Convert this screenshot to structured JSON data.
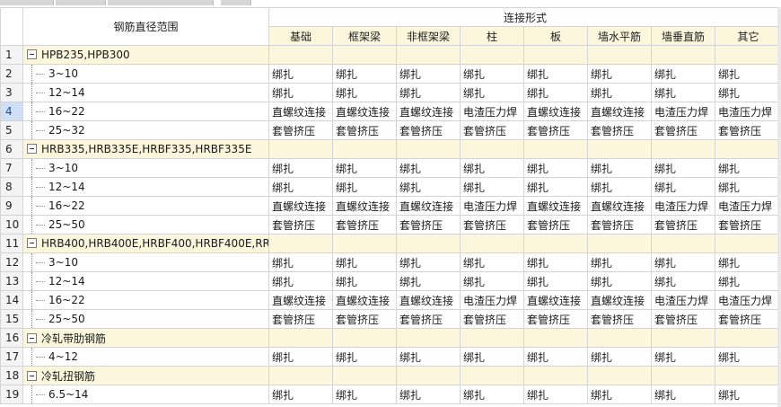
{
  "headers": {
    "range": "钢筋直径范围",
    "connection": "连接形式",
    "columns": [
      "基础",
      "框架梁",
      "非框架梁",
      "柱",
      "板",
      "墙水平筋",
      "墙垂直筋",
      "其它"
    ]
  },
  "selected_row": 4,
  "rows": [
    {
      "num": "1",
      "group": true,
      "label": "HPB235,HPB300",
      "cells": [
        "",
        "",
        "",
        "",
        "",
        "",
        "",
        ""
      ]
    },
    {
      "num": "2",
      "group": false,
      "label": "3~10",
      "cells": [
        "绑扎",
        "绑扎",
        "绑扎",
        "绑扎",
        "绑扎",
        "绑扎",
        "绑扎",
        "绑扎"
      ]
    },
    {
      "num": "3",
      "group": false,
      "label": "12~14",
      "cells": [
        "绑扎",
        "绑扎",
        "绑扎",
        "绑扎",
        "绑扎",
        "绑扎",
        "绑扎",
        "绑扎"
      ]
    },
    {
      "num": "4",
      "group": false,
      "label": "16~22",
      "cells": [
        "直螺纹连接",
        "直螺纹连接",
        "直螺纹连接",
        "电渣压力焊",
        "直螺纹连接",
        "直螺纹连接",
        "电渣压力焊",
        "电渣压力焊"
      ]
    },
    {
      "num": "5",
      "group": false,
      "label": "25~32",
      "cells": [
        "套管挤压",
        "套管挤压",
        "套管挤压",
        "套管挤压",
        "套管挤压",
        "套管挤压",
        "套管挤压",
        "套管挤压"
      ]
    },
    {
      "num": "6",
      "group": true,
      "label": "HRB335,HRB335E,HRBF335,HRBF335E",
      "cells": [
        "",
        "",
        "",
        "",
        "",
        "",
        "",
        ""
      ]
    },
    {
      "num": "7",
      "group": false,
      "label": "3~10",
      "cells": [
        "绑扎",
        "绑扎",
        "绑扎",
        "绑扎",
        "绑扎",
        "绑扎",
        "绑扎",
        "绑扎"
      ]
    },
    {
      "num": "8",
      "group": false,
      "label": "12~14",
      "cells": [
        "绑扎",
        "绑扎",
        "绑扎",
        "绑扎",
        "绑扎",
        "绑扎",
        "绑扎",
        "绑扎"
      ]
    },
    {
      "num": "9",
      "group": false,
      "label": "16~22",
      "cells": [
        "直螺纹连接",
        "直螺纹连接",
        "直螺纹连接",
        "电渣压力焊",
        "直螺纹连接",
        "直螺纹连接",
        "电渣压力焊",
        "电渣压力焊"
      ]
    },
    {
      "num": "10",
      "group": false,
      "label": "25~50",
      "cells": [
        "套管挤压",
        "套管挤压",
        "套管挤压",
        "套管挤压",
        "套管挤压",
        "套管挤压",
        "套管挤压",
        "套管挤压"
      ]
    },
    {
      "num": "11",
      "group": true,
      "label": "HRB400,HRB400E,HRBF400,HRBF400E,RR...",
      "cells": [
        "",
        "",
        "",
        "",
        "",
        "",
        "",
        ""
      ]
    },
    {
      "num": "12",
      "group": false,
      "label": "3~10",
      "cells": [
        "绑扎",
        "绑扎",
        "绑扎",
        "绑扎",
        "绑扎",
        "绑扎",
        "绑扎",
        "绑扎"
      ]
    },
    {
      "num": "13",
      "group": false,
      "label": "12~14",
      "cells": [
        "绑扎",
        "绑扎",
        "绑扎",
        "绑扎",
        "绑扎",
        "绑扎",
        "绑扎",
        "绑扎"
      ]
    },
    {
      "num": "14",
      "group": false,
      "label": "16~22",
      "cells": [
        "直螺纹连接",
        "直螺纹连接",
        "直螺纹连接",
        "电渣压力焊",
        "直螺纹连接",
        "直螺纹连接",
        "电渣压力焊",
        "电渣压力焊"
      ]
    },
    {
      "num": "15",
      "group": false,
      "label": "25~50",
      "cells": [
        "套管挤压",
        "套管挤压",
        "套管挤压",
        "套管挤压",
        "套管挤压",
        "套管挤压",
        "套管挤压",
        "套管挤压"
      ]
    },
    {
      "num": "16",
      "group": true,
      "label": "冷轧带肋钢筋",
      "cells": [
        "",
        "",
        "",
        "",
        "",
        "",
        "",
        ""
      ]
    },
    {
      "num": "17",
      "group": false,
      "label": "4~12",
      "cells": [
        "绑扎",
        "绑扎",
        "绑扎",
        "绑扎",
        "绑扎",
        "绑扎",
        "绑扎",
        "绑扎"
      ]
    },
    {
      "num": "18",
      "group": true,
      "label": "冷轧扭钢筋",
      "cells": [
        "",
        "",
        "",
        "",
        "",
        "",
        "",
        ""
      ]
    },
    {
      "num": "19",
      "group": false,
      "label": "6.5~14",
      "cells": [
        "绑扎",
        "绑扎",
        "绑扎",
        "绑扎",
        "绑扎",
        "绑扎",
        "绑扎",
        "绑扎"
      ]
    }
  ]
}
